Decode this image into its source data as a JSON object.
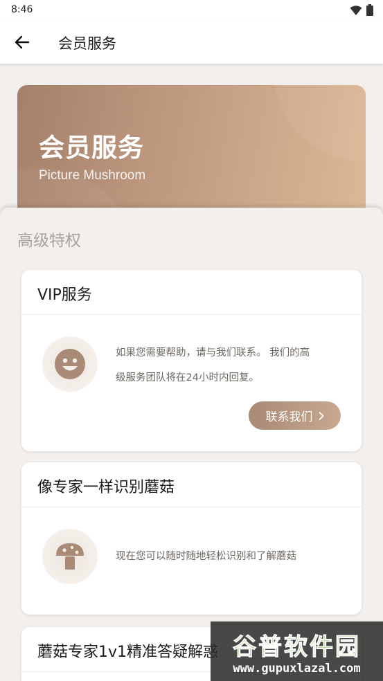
{
  "status_bar": {
    "time": "8:46"
  },
  "app_bar": {
    "title": "会员服务"
  },
  "hero": {
    "title": "会员服务",
    "subtitle": "Picture Mushroom"
  },
  "section": {
    "title": "高级特权"
  },
  "cards": [
    {
      "title": "VIP服务",
      "icon": "smiley-face-icon",
      "text_line1": "如果您需要帮助，请与我们联系。 我们的高",
      "text_line2": "级服务团队将在24小时内回复。",
      "button_label": "联系我们"
    },
    {
      "title": "像专家一样识别蘑菇",
      "icon": "mushroom-icon",
      "text_line1": "现在您可以随时随地轻松识别和了解蘑菇"
    },
    {
      "title": "蘑菇专家1v1精准答疑解惑"
    }
  ],
  "watermark": {
    "big": "谷普软件园",
    "small": "www.gupuxlazal.com"
  },
  "colors": {
    "accent": "#b3917b",
    "icon_fill": "#a88a76"
  }
}
